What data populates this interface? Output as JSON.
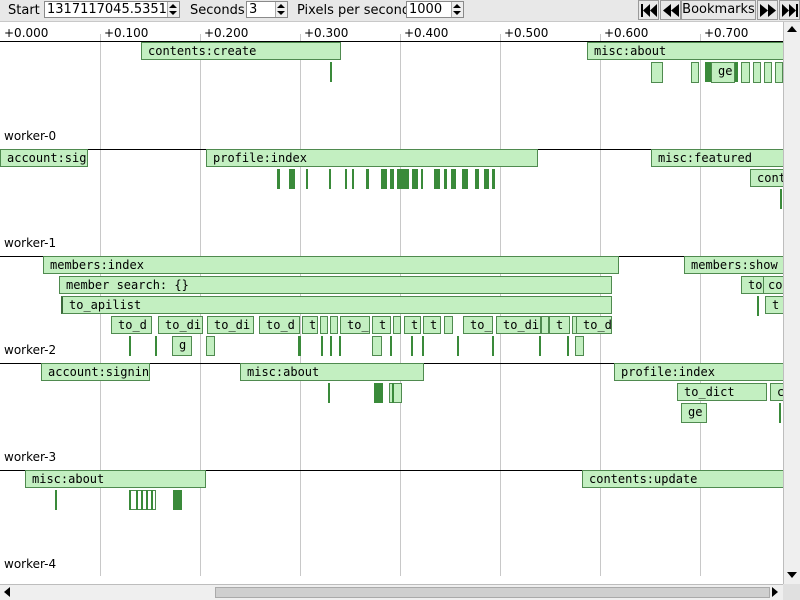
{
  "toolbar": {
    "start_label": "Start",
    "start_value": "1317117045.53516",
    "seconds_label": "Seconds",
    "seconds_value": "3",
    "pps_label": "Pixels per second",
    "pps_value": "1000",
    "bookmarks_label": "Bookmarks"
  },
  "axis_ticks": [
    "+0.000",
    "+0.100",
    "+0.200",
    "+0.300",
    "+0.400",
    "+0.500",
    "+0.600",
    "+0.700"
  ],
  "workers": [
    {
      "label": "worker-0"
    },
    {
      "label": "worker-1"
    },
    {
      "label": "worker-2"
    },
    {
      "label": "worker-3"
    },
    {
      "label": "worker-4"
    }
  ],
  "blocks": {
    "w0_contents_create": "contents:create",
    "w0_misc_about": "misc:about",
    "w0_ge": "ge",
    "w1_account_sig": "account:sig",
    "w1_profile_index": "profile:index",
    "w1_misc_featured": "misc:featured",
    "w1_cont": "cont",
    "w2_members_index": "members:index",
    "w2_member_search": "member search: {}",
    "w2_to_apilist": "to_apilist",
    "w2_to_d1": "to_d",
    "w2_to_di1": "to_di",
    "w2_g": "g",
    "w2_to_di2": "to_di",
    "w2_to_d2": "to_d",
    "w2_t1": "t",
    "w2_to_1": "to_",
    "w2_t2": "t",
    "w2_t3": "t",
    "w2_t4": "t",
    "w2_to_2": "to_",
    "w2_to_di3": "to_di",
    "w2_t5": "t",
    "w2_to_d3": "to_d",
    "w2_members_show": "members:show",
    "w2_to": "to",
    "w2_co": "co",
    "w2_t6": "t",
    "w3_account_signin": "account:signin",
    "w3_misc_about": "misc:about",
    "w3_profile_index": "profile:index",
    "w3_to_dict": "to_dict",
    "w3_ge": "ge",
    "w3_c": "c",
    "w4_misc_about": "misc:about",
    "w4_contents_update": "contents:update"
  }
}
